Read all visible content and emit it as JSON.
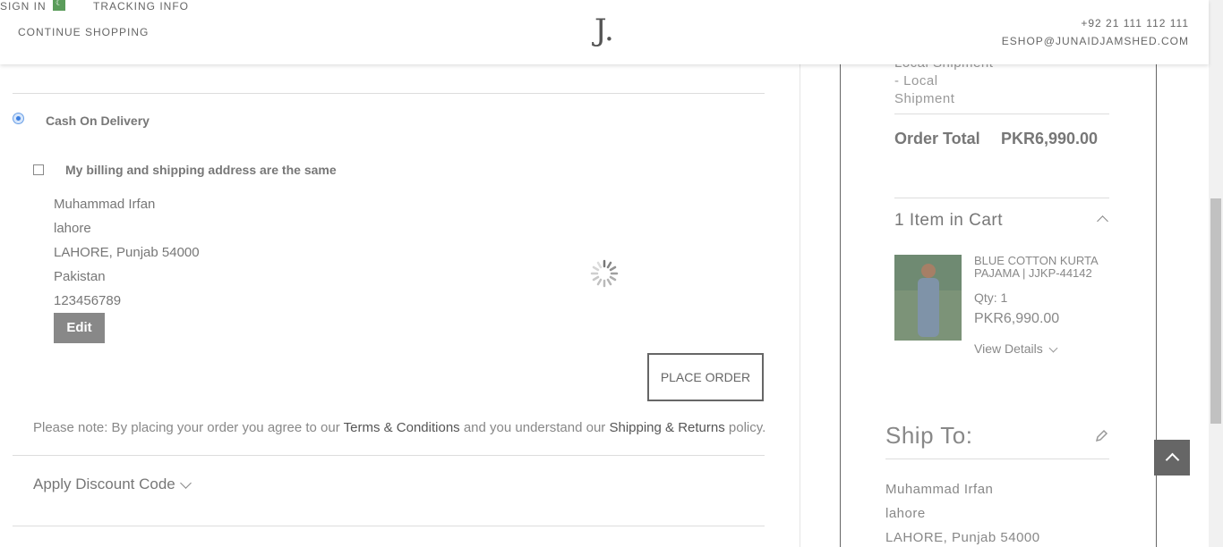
{
  "header": {
    "sign_in": "SIGN IN",
    "tracking": "TRACKING INFO",
    "continue": "CONTINUE SHOPPING",
    "logo": "J.",
    "phone": "+92 21 111 112 111",
    "email": "ESHOP@JUNAIDJAMSHED.COM"
  },
  "payment": {
    "method_label": "Cash On Delivery",
    "same_address_label": "My billing and shipping address are the same",
    "address": [
      "Muhammad Irfan",
      "lahore",
      "LAHORE, Punjab 54000",
      "Pakistan",
      "123456789"
    ],
    "edit_label": "Edit",
    "place_order_label": "PLACE ORDER",
    "note_prefix": "Please note: By placing your order you agree to our ",
    "terms_link": "Terms & Conditions",
    "note_middle": " and you understand our ",
    "shipping_link": "Shipping & Returns",
    "note_suffix": " policy.",
    "discount_label": "Apply Discount Code"
  },
  "summary": {
    "shipment_lines": [
      "Local Shipment",
      "- Local",
      "Shipment"
    ],
    "order_total_label": "Order Total",
    "order_total_value": "PKR6,990.00",
    "cart_title": "1 Item in Cart",
    "item_name": "BLUE COTTON KURTA PAJAMA | JJKP-44142",
    "item_qty": "Qty: 1",
    "item_price": "PKR6,990.00",
    "view_details": "View Details",
    "ship_to_title": "Ship To:",
    "ship_to_address": [
      "Muhammad Irfan",
      "lahore",
      "LAHORE, Punjab 54000"
    ]
  },
  "colors": {
    "accent_gray": "#888888",
    "radio_blue": "#3a7ee0"
  }
}
